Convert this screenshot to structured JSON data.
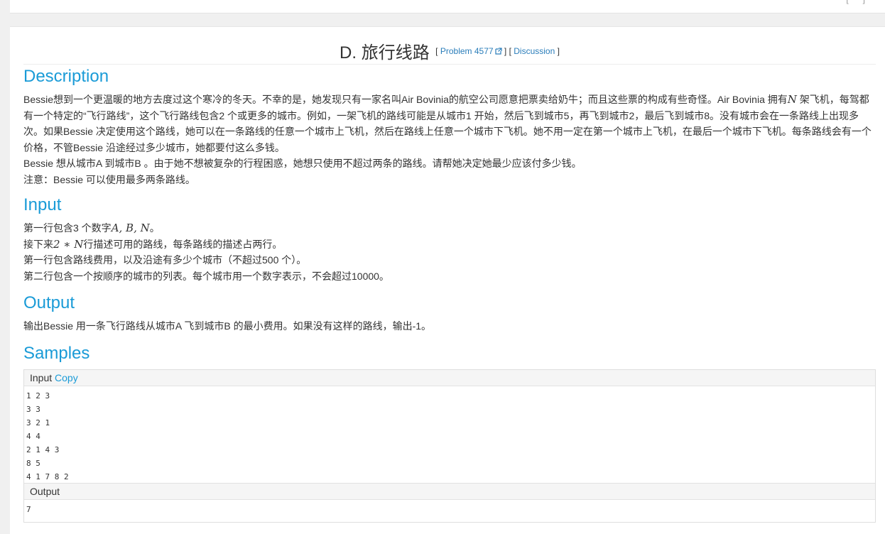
{
  "header": {
    "title": "D. 旅行线路",
    "problem_link": "Problem 4577",
    "discussion_link": "Discussion"
  },
  "description": {
    "heading": "Description",
    "paragraphs": [
      "Bessie想到一个更温暖的地方去度过这个寒冷的冬天。不幸的是，她发现只有一家名叫Air Bovinia的航空公司愿意把票卖给奶牛；而且这些票的构成有些奇怪。Air Bovinia 拥有",
      "架飞机，每驾都有一个特定的“飞行路线”，这个飞行路线包含2 个或更多的城市。例如，一架飞机的路线可能是从城市1 开始，然后飞到城市5，再飞到城市2，最后飞到城市8。没有城市会在一条路线上出现多次。如果Bessie 决定使用这个路线，她可以在一条路线的任意一个城市上飞机，然后在路线上任意一个城市下飞机。她不用一定在第一个城市上飞机，在最后一个城市下飞机。每条路线会有一个价格，不管Bessie 沿途经过多少城市，她都要付这么多钱。",
      "Bessie 想从城市A 到城市B 。由于她不想被复杂的行程困惑，她想只使用不超过两条的路线。请帮她决定她最少应该付多少钱。",
      "注意：Bessie 可以使用最多两条路线。"
    ],
    "math_N": "N"
  },
  "input": {
    "heading": "Input",
    "line1_pre": "第一行包含3 个数字",
    "line1_math": "A, B, N",
    "line1_post": "。",
    "line2_pre": "接下来",
    "line2_math": "2 ∗ N",
    "line2_post": "行描述可用的路线，每条路线的描述占两行。",
    "line3": "第一行包含路线费用，以及沿途有多少个城市（不超过500 个）。",
    "line4": "第二行包含一个按顺序的城市的列表。每个城市用一个数字表示，不会超过10000。"
  },
  "output": {
    "heading": "Output",
    "text": "输出Bessie 用一条飞行路线从城市A 飞到城市B 的最小费用。如果没有这样的路线，输出-1。"
  },
  "samples": {
    "heading": "Samples",
    "input_label": "Input",
    "copy_label": "Copy",
    "input_text": "1 2 3\n3 3\n3 2 1\n4 4\n2 1 4 3\n8 5\n4 1 7 8 2",
    "output_label": "Output",
    "output_text": "7"
  }
}
